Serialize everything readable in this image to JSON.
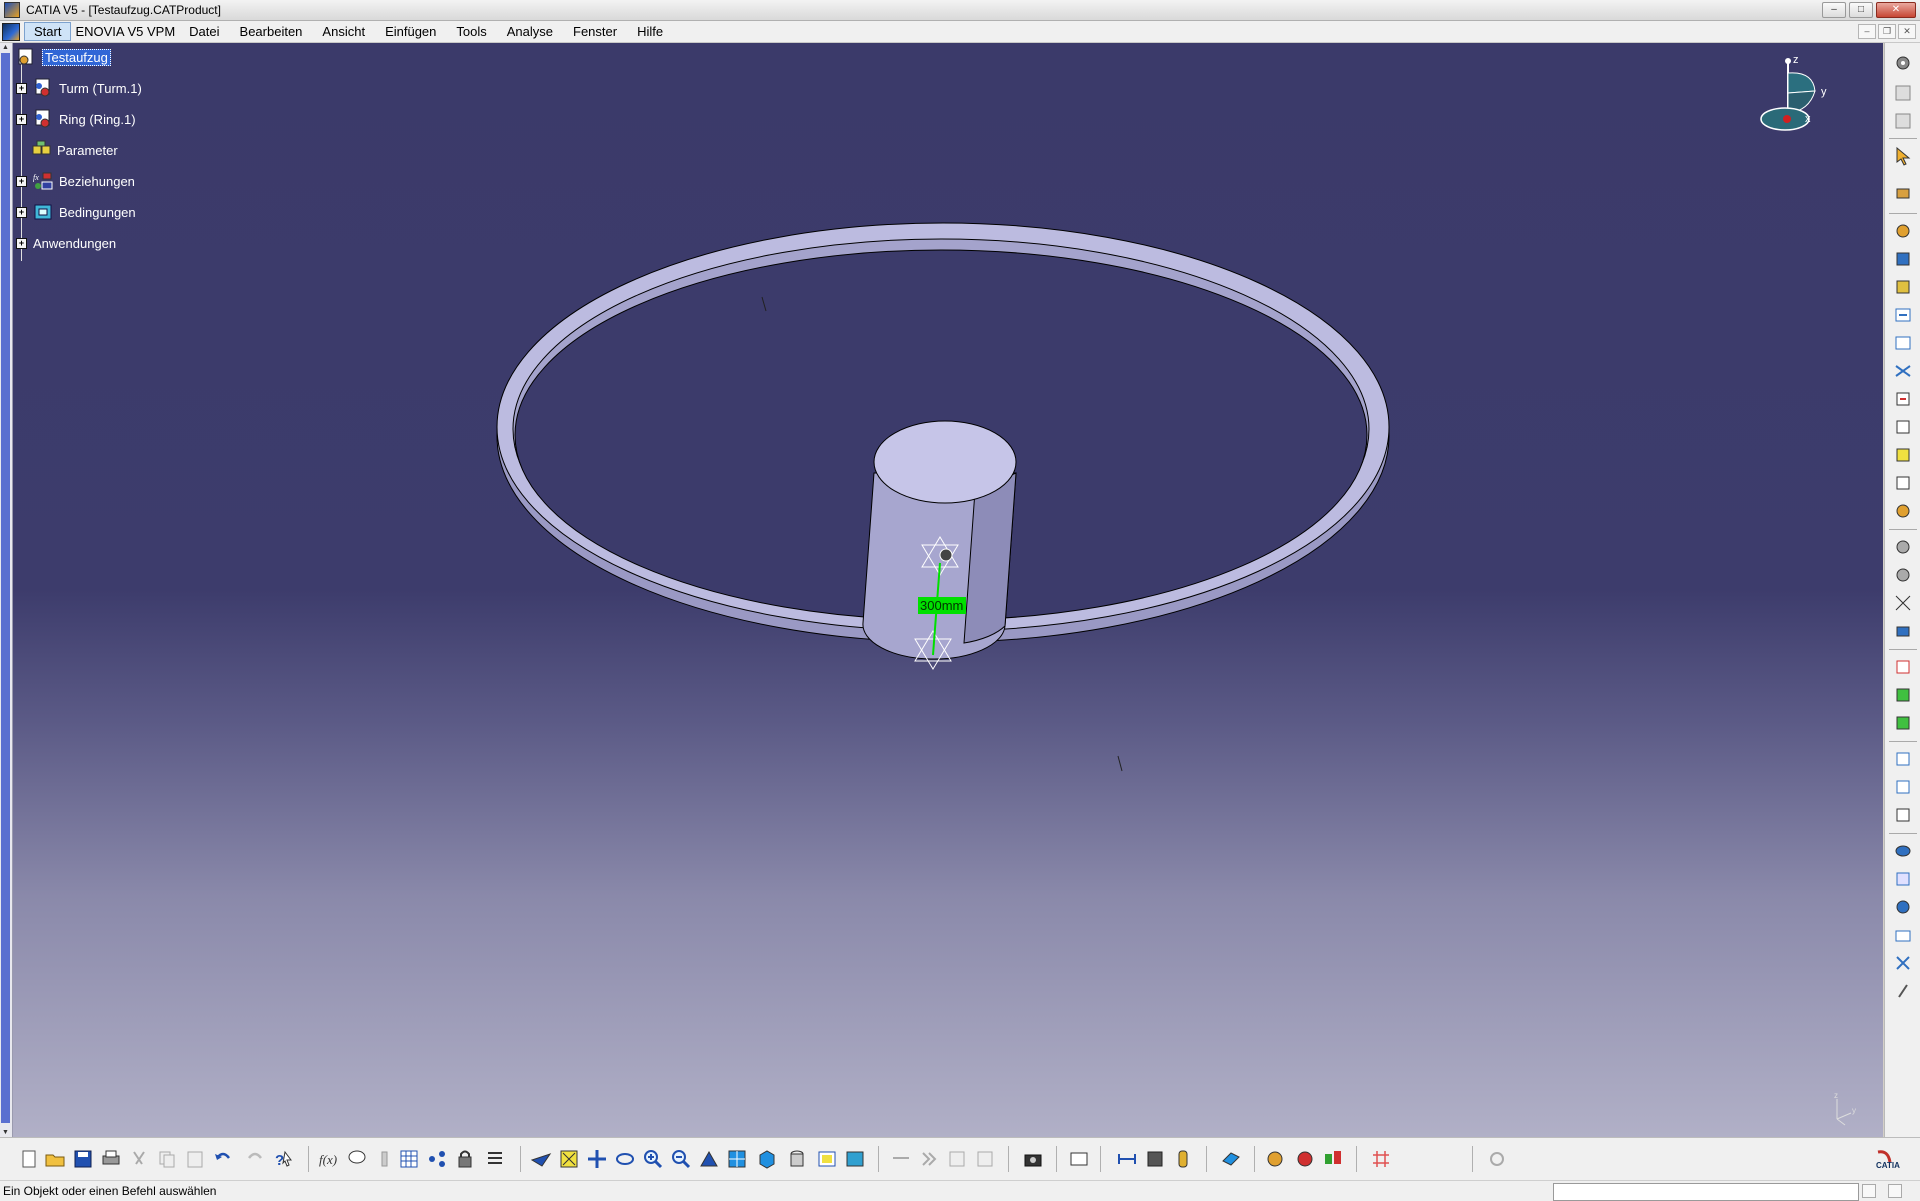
{
  "window": {
    "title": "CATIA V5 - [Testaufzug.CATProduct]"
  },
  "menubar": {
    "items": [
      "Start",
      "ENOVIA V5 VPM",
      "Datei",
      "Bearbeiten",
      "Ansicht",
      "Einfügen",
      "Tools",
      "Analyse",
      "Fenster",
      "Hilfe"
    ],
    "active": "Start"
  },
  "tree": {
    "root": "Testaufzug",
    "nodes": [
      {
        "label": "Turm (Turm.1)",
        "icon": "part-icon"
      },
      {
        "label": "Ring (Ring.1)",
        "icon": "part-icon"
      },
      {
        "label": "Parameter",
        "icon": "parameter-icon"
      },
      {
        "label": "Beziehungen",
        "icon": "relations-icon"
      },
      {
        "label": "Bedingungen",
        "icon": "constraints-icon"
      }
    ],
    "applications": "Anwendungen"
  },
  "scene": {
    "dimension_label": "300mm",
    "dimension_color": "#00e000",
    "background_top": "#3b3a6a",
    "background_bottom": "#b1b0c7",
    "part_color": "#b9b8dc"
  },
  "compass": {
    "axis_x": "x",
    "axis_y": "y",
    "axis_z": "z"
  },
  "statusbar": {
    "message": "Ein Objekt oder einen Befehl auswählen",
    "command_input": ""
  },
  "selection_color": "#3066d6"
}
